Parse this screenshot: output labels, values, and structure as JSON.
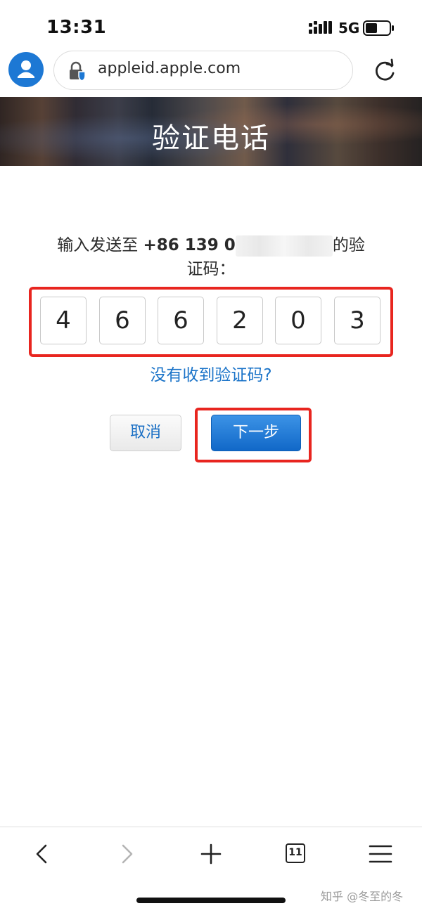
{
  "status_bar": {
    "time": "13:31",
    "network": "5G"
  },
  "browser": {
    "url": "appleid.apple.com",
    "tab_count": "11",
    "icons": {
      "avatar": "profile-avatar-icon",
      "lock": "lock-shield-icon",
      "reload": "reload-icon",
      "back": "back-arrow-icon",
      "forward": "forward-arrow-icon",
      "new_tab": "plus-icon",
      "tabs": "tabs-icon",
      "menu": "hamburger-menu-icon"
    }
  },
  "page": {
    "banner_title": "验证电话",
    "instruction_before": "输入发送至 ",
    "phone_prefix": "+86 139 0",
    "instruction_after_line1": "的验",
    "instruction_line2": "证码：",
    "code_digits": [
      "4",
      "6",
      "6",
      "2",
      "0",
      "3"
    ],
    "help_link": "没有收到验证码?",
    "cancel_label": "取消",
    "next_label": "下一步"
  },
  "watermark": "知乎 @冬至的冬",
  "colors": {
    "accent_blue": "#1a73c8",
    "button_blue": "#1168c8",
    "highlight_red": "#e8251f",
    "avatar_blue": "#1d78d4"
  }
}
